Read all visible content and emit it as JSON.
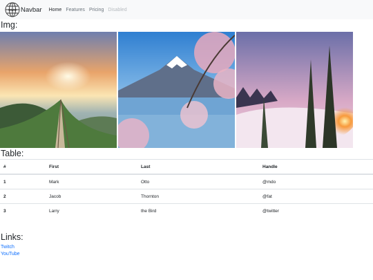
{
  "navbar": {
    "brand": "Navbar",
    "links": [
      {
        "label": "Home"
      },
      {
        "label": "Features"
      },
      {
        "label": "Pricing"
      },
      {
        "label": "Disabled"
      }
    ]
  },
  "sections": {
    "img": "Img:",
    "table": "Table:",
    "links": "Links:"
  },
  "images": [
    {
      "subject": "sunset over green hilltop path"
    },
    {
      "subject": "snow-capped mountain with cherry blossoms by a lake"
    },
    {
      "subject": "sunrise through snowy pine forest"
    }
  ],
  "table": {
    "headers": [
      "#",
      "First",
      "Last",
      "Handle"
    ],
    "rows": [
      [
        "1",
        "Mark",
        "Otto",
        "@mdo"
      ],
      [
        "2",
        "Jacob",
        "Thornton",
        "@fat"
      ],
      [
        "3",
        "Larry",
        "the Bird",
        "@twitter"
      ]
    ]
  },
  "links": [
    {
      "label": "Twitch"
    },
    {
      "label": "YouTube"
    }
  ],
  "colors": {
    "navbar_bg": "#f8f9fa",
    "link": "#0d6efd",
    "muted": "#6c757d"
  }
}
